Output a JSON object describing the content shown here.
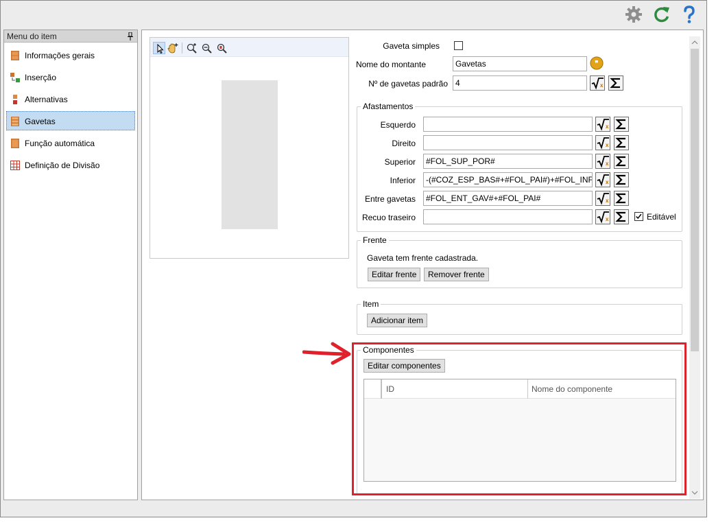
{
  "toolbar": {
    "icons": [
      "gear-icon",
      "refresh-icon",
      "help-icon"
    ],
    "colors": {
      "gear": "#8e8e8e",
      "refresh": "#2e8b3e",
      "help": "#2a73c9"
    }
  },
  "sidebar": {
    "title": "Menu do item",
    "items": [
      {
        "label": "Informações gerais",
        "icon": "cabinet-icon"
      },
      {
        "label": "Inserção",
        "icon": "insert-icon"
      },
      {
        "label": "Alternativas",
        "icon": "alternatives-icon"
      },
      {
        "label": "Gavetas",
        "icon": "drawers-icon",
        "active": true
      },
      {
        "label": "Função automática",
        "icon": "auto-function-icon"
      },
      {
        "label": "Definição de Divisão",
        "icon": "grid-division-icon"
      }
    ]
  },
  "preview": {
    "tools": [
      "select-arrow-icon",
      "pan-hand-icon",
      "zoom-in-icon",
      "zoom-out-icon",
      "zoom-fit-icon"
    ]
  },
  "form": {
    "gaveta_simples_label": "Gaveta simples",
    "gaveta_simples_checked": false,
    "nome_montante_label": "Nome do montante",
    "nome_montante_value": "Gavetas",
    "n_gavetas_label": "Nº de gavetas padrão",
    "n_gavetas_value": "4"
  },
  "afastamentos": {
    "title": "Afastamentos",
    "rows": [
      {
        "label": "Esquerdo",
        "value": ""
      },
      {
        "label": "Direito",
        "value": ""
      },
      {
        "label": "Superior",
        "value": "#FOL_SUP_POR#"
      },
      {
        "label": "Inferior",
        "value": "-(#COZ_ESP_BAS#+#FOL_PAI#)+#FOL_INF_F"
      },
      {
        "label": "Entre gavetas",
        "value": "#FOL_ENT_GAV#+#FOL_PAI#"
      },
      {
        "label": "Recuo traseiro",
        "value": ""
      }
    ],
    "editavel_label": "Editável",
    "editavel_checked": true
  },
  "frente": {
    "title": "Frente",
    "status": "Gaveta tem frente cadastrada.",
    "edit_button": "Editar frente",
    "remove_button": "Remover frente"
  },
  "item": {
    "title": "Item",
    "add_button": "Adicionar item"
  },
  "componentes": {
    "title": "Componentes",
    "edit_button": "Editar componentes",
    "columns": [
      "ID",
      "Nome do componente"
    ],
    "rows": []
  },
  "annotation": {
    "highlight_color": "#e0202a"
  }
}
